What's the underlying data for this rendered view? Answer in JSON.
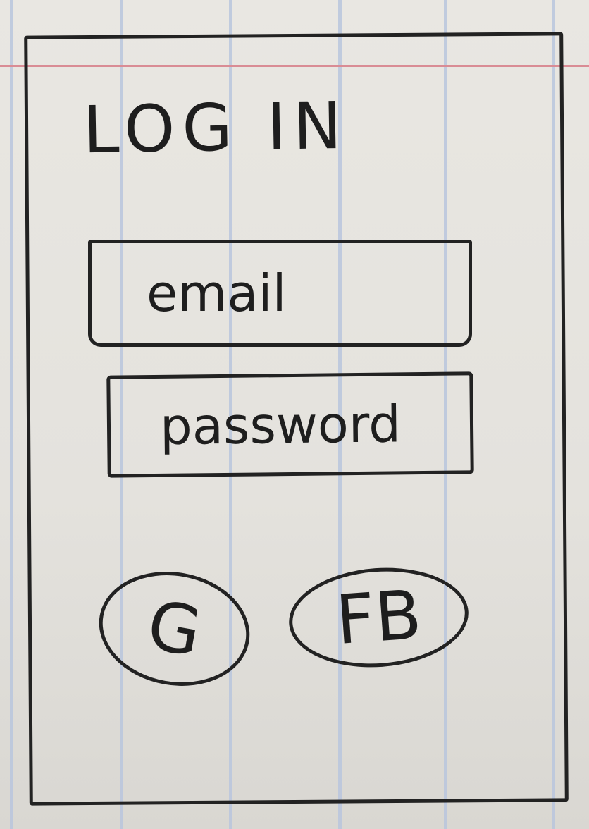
{
  "login": {
    "title": "LOG IN",
    "email_placeholder": "email",
    "password_placeholder": "password",
    "google_label": "G",
    "facebook_label": "FB"
  },
  "colors": {
    "paper": "#e6e4df",
    "ruled_line": "#b9c6dd",
    "margin_line": "#d98c95",
    "ink": "#222222"
  }
}
